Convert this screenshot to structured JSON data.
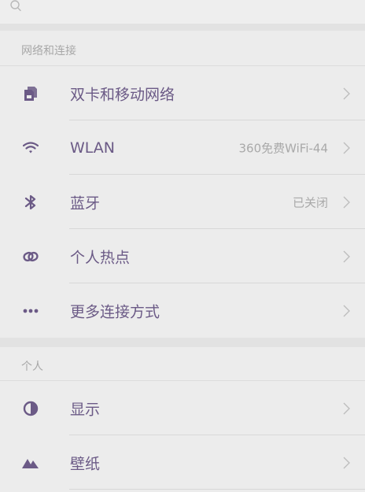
{
  "search": {
    "icon": "search-icon"
  },
  "sections": [
    {
      "header": "网络和连接",
      "items": [
        {
          "label": "双卡和移动网络",
          "value": "",
          "icon": "sim-card-icon"
        },
        {
          "label": "WLAN",
          "value": "360免费WiFi-44",
          "icon": "wifi-icon"
        },
        {
          "label": "蓝牙",
          "value": "已关闭",
          "icon": "bluetooth-icon"
        },
        {
          "label": "个人热点",
          "value": "",
          "icon": "hotspot-icon"
        },
        {
          "label": "更多连接方式",
          "value": "",
          "icon": "more-dots-icon"
        }
      ]
    },
    {
      "header": "个人",
      "items": [
        {
          "label": "显示",
          "value": "",
          "icon": "display-contrast-icon"
        },
        {
          "label": "壁纸",
          "value": "",
          "icon": "wallpaper-mountain-icon"
        }
      ]
    }
  ],
  "colors": {
    "accent": "#6b5a86",
    "icon": "#6b5a86",
    "secondary_text": "#a9a9a9",
    "background": "#ececec"
  }
}
